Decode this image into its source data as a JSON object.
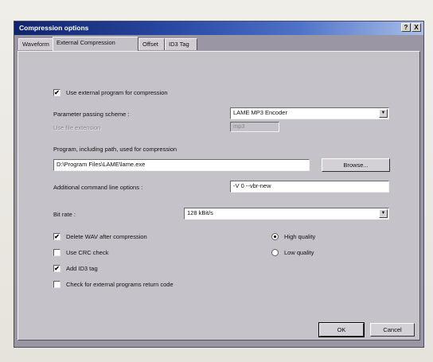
{
  "window": {
    "title": "Compression options",
    "help_label": "?",
    "close_label": "X"
  },
  "tabs": [
    {
      "label": "Waveform"
    },
    {
      "label": "External Compression"
    },
    {
      "label": "Offset"
    },
    {
      "label": "ID3 Tag"
    }
  ],
  "options": {
    "use_external_label": "Use external program for compression",
    "use_external_checked": true,
    "param_scheme_label": "Parameter passing scheme :",
    "param_scheme_value": "LAME MP3 Encoder",
    "file_ext_label": "Use file extension",
    "file_ext_value": "mp3",
    "program_label": "Program, including path, used for compression",
    "program_value": "D:\\Program Files\\LAME\\lame.exe",
    "browse_label": "Browse...",
    "cmd_options_label": "Additional command line options :",
    "cmd_options_value": "-V 0 --vbr-new",
    "bitrate_label": "Bit rate :",
    "bitrate_value": "128 kBit/s",
    "delete_wav_label": "Delete WAV after compression",
    "delete_wav_checked": true,
    "crc_label": "Use CRC check",
    "crc_checked": false,
    "id3_label": "Add ID3 tag",
    "id3_checked": true,
    "return_code_label": "Check for external programs return code",
    "return_code_checked": false,
    "high_quality_label": "High quality",
    "high_quality_selected": true,
    "low_quality_label": "Low quality",
    "low_quality_selected": false
  },
  "footer": {
    "ok_label": "OK",
    "cancel_label": "Cancel"
  },
  "check_mark": "✔",
  "colors": {
    "title_bar_start": "#10246a",
    "title_bar_end": "#a9c0e8",
    "window_frame": "#9b96a4",
    "panel": "#c6c2ca"
  }
}
